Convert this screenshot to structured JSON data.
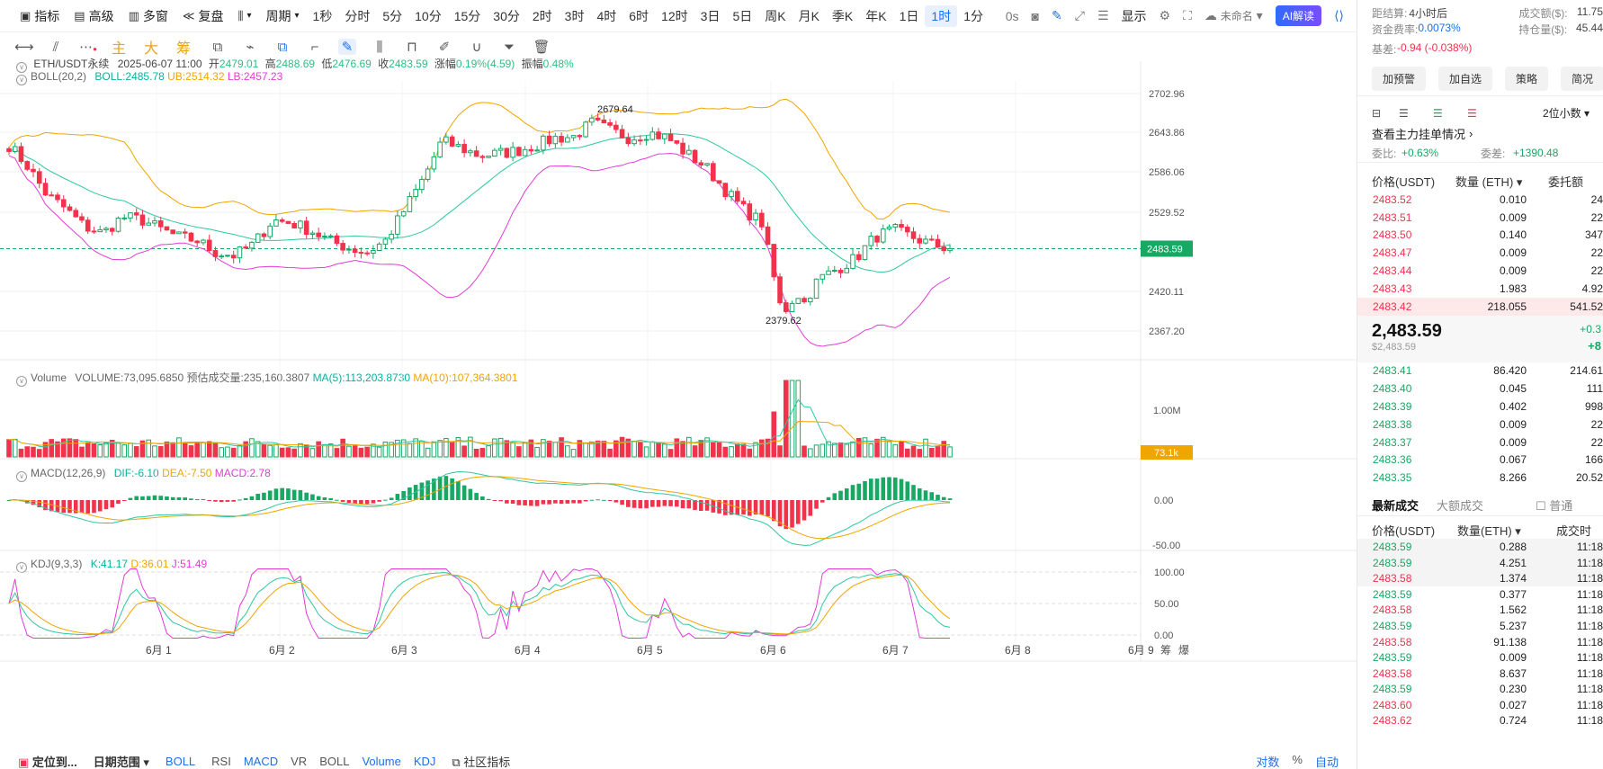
{
  "topbar": {
    "indicators": "指标",
    "advanced": "高级",
    "multi_window": "多窗",
    "replay": "复盘",
    "period": "周期",
    "intervals": [
      "1秒",
      "分时",
      "5分",
      "10分",
      "15分",
      "30分",
      "2时",
      "3时",
      "4时",
      "6时",
      "12时",
      "3日",
      "5日",
      "周K",
      "月K",
      "季K",
      "年K",
      "1日",
      "1时",
      "1分"
    ],
    "active_interval": "1时",
    "zero_s": "0s",
    "display": "显示",
    "unnamed": "未命名",
    "ai": "AI解读"
  },
  "toolbar": {
    "chars": [
      "主",
      "大",
      "筹"
    ]
  },
  "legend": {
    "pair": "ETH/USDT永续",
    "date": "2025-06-07 11:00",
    "open_label": "开",
    "open": "2479.01",
    "high_label": "高",
    "high": "2488.69",
    "low_label": "低",
    "low": "2476.69",
    "close_label": "收",
    "close": "2483.59",
    "chg_label": "涨幅",
    "chg": "0.19%(4.59)",
    "amp_label": "振幅",
    "amp": "0.48%",
    "boll": "BOLL(20,2)",
    "boll_mid": "BOLL:2485.78",
    "boll_ub": "UB:2514.32",
    "boll_lb": "LB:2457.23",
    "vol": "Volume",
    "vol_val": "VOLUME:73,095.6850",
    "vol_est": "预估成交量:235,160.3807",
    "ma5": "MA(5):113,203.8730",
    "ma10": "MA(10):107,364.3801",
    "macd": "MACD(12,26,9)",
    "dif": "DIF:-6.10",
    "dea": "DEA:-7.50",
    "macd_val": "MACD:2.78",
    "kdj": "KDJ(9,3,3)",
    "k": "K:41.17",
    "d": "D:36.01",
    "j": "J:51.49"
  },
  "price_axis": [
    "2702.96",
    "2643.86",
    "2586.06",
    "2529.52",
    "2420.11",
    "2367.20"
  ],
  "current_price_tag": "2483.59",
  "vol_axis": [
    "1.00M"
  ],
  "vol_tag": "73.1k",
  "macd_axis": [
    "0.00",
    "-50.00"
  ],
  "kdj_axis": [
    "100.00",
    "50.00",
    "0.00"
  ],
  "high_mark": "2679.64",
  "low_mark": "2379.62",
  "date_axis": [
    "6月 1",
    "6月 2",
    "6月 3",
    "6月 4",
    "6月 5",
    "6月 6",
    "6月 7",
    "6月 8",
    "6月 9"
  ],
  "bottombar": {
    "locate": "定位到...",
    "date_range": "日期范围",
    "boll": "BOLL",
    "tabs": [
      "RSI",
      "MACD",
      "VR",
      "BOLL",
      "Volume",
      "KDJ"
    ],
    "community": "社区指标",
    "log": "对数",
    "pct": "%",
    "auto": "自动"
  },
  "side": {
    "settle_label": "距结算:",
    "settle": "4小时后",
    "turnover_label": "成交额($):",
    "turnover": "11.75",
    "funding_label": "资金费率:",
    "funding": "0.0073%",
    "oi_label": "持仓量($):",
    "oi": "45.44",
    "basis_label": "基差:",
    "basis": "-0.94 (-0.038%)",
    "buttons": [
      "加预警",
      "加自选",
      "策略",
      "简况"
    ],
    "decimals": "2位小数",
    "depth_link": "查看主力挂单情况",
    "ratio_label": "委比:",
    "ratio": "+0.63%",
    "diff_label": "委差:",
    "diff": "+1390.48",
    "ob_headers": [
      "价格(USDT)",
      "数量 (ETH)",
      "委托额"
    ],
    "asks": [
      [
        "2483.52",
        "0.010",
        "24"
      ],
      [
        "2483.51",
        "0.009",
        "22"
      ],
      [
        "2483.50",
        "0.140",
        "347"
      ],
      [
        "2483.47",
        "0.009",
        "22"
      ],
      [
        "2483.44",
        "0.009",
        "22"
      ],
      [
        "2483.43",
        "1.983",
        "4.92"
      ],
      [
        "2483.42",
        "218.055",
        "541.52"
      ]
    ],
    "last_price": "2,483.59",
    "last_usd": "$2,483.59",
    "chg_a": "+0.3",
    "chg_b": "+8",
    "bids": [
      [
        "2483.41",
        "86.420",
        "214.61"
      ],
      [
        "2483.40",
        "0.045",
        "111"
      ],
      [
        "2483.39",
        "0.402",
        "998"
      ],
      [
        "2483.38",
        "0.009",
        "22"
      ],
      [
        "2483.37",
        "0.009",
        "22"
      ],
      [
        "2483.36",
        "0.067",
        "166"
      ],
      [
        "2483.35",
        "8.266",
        "20.52"
      ]
    ],
    "trades_tab": "最新成交",
    "big_tab": "大额成交",
    "normal": "普通",
    "trade_headers": [
      "价格(USDT)",
      "数量(ETH)",
      "成交时"
    ],
    "trades": [
      [
        "2483.59",
        "0.288",
        "11:18",
        "g"
      ],
      [
        "2483.59",
        "4.251",
        "11:18",
        "g"
      ],
      [
        "2483.58",
        "1.374",
        "11:18",
        "r"
      ],
      [
        "2483.59",
        "0.377",
        "11:18",
        "g"
      ],
      [
        "2483.58",
        "1.562",
        "11:18",
        "r"
      ],
      [
        "2483.59",
        "5.237",
        "11:18",
        "g"
      ],
      [
        "2483.58",
        "91.138",
        "11:18",
        "r"
      ],
      [
        "2483.59",
        "0.009",
        "11:18",
        "g"
      ],
      [
        "2483.58",
        "8.637",
        "11:18",
        "r"
      ],
      [
        "2483.59",
        "0.230",
        "11:18",
        "g"
      ],
      [
        "2483.60",
        "0.027",
        "11:18",
        "r"
      ],
      [
        "2483.62",
        "0.724",
        "11:18",
        "r"
      ]
    ]
  },
  "chart_data": {
    "type": "candlestick",
    "pair": "ETH/USDT永续",
    "interval": "1时",
    "price_axis_ticks": [
      2702.96,
      2643.86,
      2586.06,
      2529.52,
      2420.11,
      2367.2
    ],
    "x_ticks": [
      "6月 1",
      "6月 2",
      "6月 3",
      "6月 4",
      "6月 5",
      "6月 6",
      "6月 7",
      "6月 8",
      "6月 9"
    ],
    "current_price": 2483.59,
    "marked_high": 2679.64,
    "marked_low": 2379.62,
    "close_path_keypoints": [
      2630,
      2600,
      2560,
      2540,
      2515,
      2505,
      2528,
      2525,
      2512,
      2500,
      2495,
      2478,
      2474,
      2490,
      2524,
      2520,
      2510,
      2495,
      2485,
      2478,
      2495,
      2538,
      2582,
      2636,
      2626,
      2615,
      2618,
      2622,
      2630,
      2640,
      2642,
      2662,
      2650,
      2640,
      2648,
      2640,
      2618,
      2600,
      2568,
      2540,
      2520,
      2400,
      2396,
      2440,
      2455,
      2470,
      2500,
      2510,
      2500,
      2490,
      2483.59
    ]
  }
}
